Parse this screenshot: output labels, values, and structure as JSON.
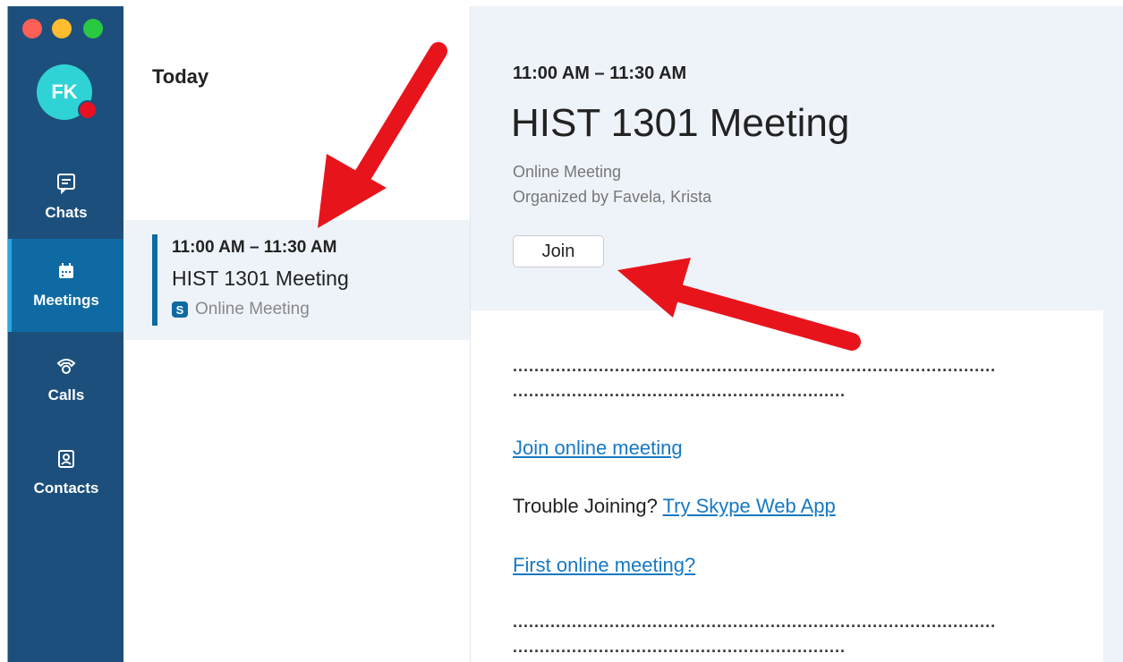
{
  "rail": {
    "avatar_initials": "FK",
    "items": [
      {
        "label": "Chats",
        "icon": "chat-icon"
      },
      {
        "label": "Meetings",
        "icon": "calendar-icon"
      },
      {
        "label": "Calls",
        "icon": "phone-icon"
      },
      {
        "label": "Contacts",
        "icon": "contacts-icon"
      }
    ],
    "active": "Meetings"
  },
  "list": {
    "section_title": "Today",
    "meeting": {
      "time": "11:00 AM – 11:30 AM",
      "title": "HIST 1301 Meeting",
      "type": "Online Meeting",
      "type_icon": "skype-icon"
    }
  },
  "detail": {
    "time": "11:00 AM – 11:30 AM",
    "title": "HIST 1301 Meeting",
    "subtitle": "Online Meeting",
    "organizer": "Organized by Favela, Krista",
    "join_label": "Join",
    "body": {
      "dots_long": "..........................................................................................",
      "dots_short": "..............................................................",
      "join_link": "Join online meeting",
      "trouble_text": "Trouble Joining?",
      "web_app_link": "Try Skype Web App",
      "first_link": "First online meeting?"
    }
  },
  "colors": {
    "rail": "#1d4f7c",
    "rail_active": "#0f6aa3",
    "link": "#1779c4",
    "annotation_arrow": "#e8141c"
  }
}
